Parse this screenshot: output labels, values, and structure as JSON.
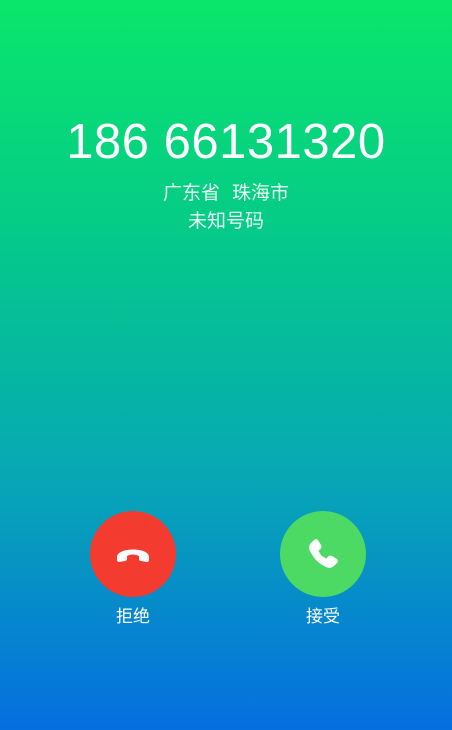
{
  "call": {
    "number": "186 66131320",
    "location": "广东省  珠海市",
    "tag": "未知号码"
  },
  "actions": {
    "decline_label": "拒绝",
    "accept_label": "接受",
    "decline_icon": "hang-up-icon",
    "accept_icon": "phone-icon"
  },
  "colors": {
    "decline": "#f33b2f",
    "accept": "#4cd964",
    "background_top": "#0ae66c",
    "background_bottom": "#066ee0"
  }
}
